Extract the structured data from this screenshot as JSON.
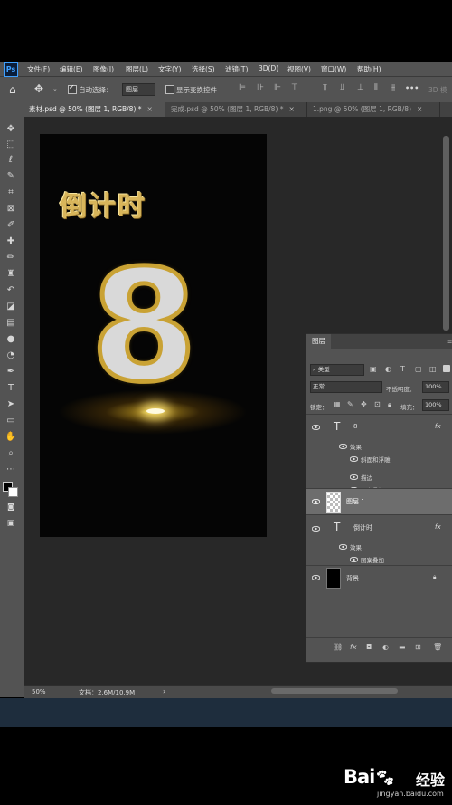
{
  "app": {
    "logo_text": "Ps"
  },
  "menu": [
    "文件(F)",
    "编辑(E)",
    "图像(I)",
    "图层(L)",
    "文字(Y)",
    "选择(S)",
    "滤镜(T)",
    "3D(D)",
    "视图(V)",
    "窗口(W)",
    "帮助(H)"
  ],
  "options": {
    "auto_select_label": "自动选择：",
    "auto_select_checked": true,
    "auto_select_target": "图层",
    "show_transform_label": "显示变换控件",
    "show_transform_checked": false,
    "more_label": "•••",
    "mode_3d_label": "3D 模"
  },
  "tabs": [
    {
      "title": "素材.psd @ 50% (图层 1, RGB/8) *",
      "close": "×",
      "active": true
    },
    {
      "title": "完成.psd @ 50% (图层 1, RGB/8) *",
      "close": "×",
      "active": false
    },
    {
      "title": "1.png @ 50% (图层 1, RGB/8)",
      "close": "×",
      "active": false
    }
  ],
  "canvas": {
    "title_text": "倒计时",
    "number_text": "8",
    "accent_gold": "#d8b55a"
  },
  "layers_panel": {
    "tab_label": "图层",
    "filter_kind": "类型",
    "blend_mode": "正常",
    "opacity_label": "不透明度：",
    "opacity_value": "100%",
    "lock_label": "锁定：",
    "fill_label": "填充：",
    "fill_value": "100%",
    "layers": [
      {
        "type": "text",
        "name": "8",
        "fx": "fx",
        "effects_label": "效果",
        "effects": [
          "斜面和浮雕",
          "描边",
          "图案叠加"
        ]
      },
      {
        "type": "pixel",
        "name": "图层 1",
        "selected": true
      },
      {
        "type": "text",
        "name": "倒计时",
        "fx": "fx",
        "effects_label": "效果",
        "effects": [
          "图案叠加"
        ]
      },
      {
        "type": "background",
        "name": "背景",
        "locked": true
      }
    ]
  },
  "status": {
    "zoom": "50%",
    "doc_info": "文档：2.6M/10.9M",
    "arrow": "›"
  },
  "watermark": {
    "brand": "Bai",
    "brand_suffix": "百",
    "cn": "经验",
    "url": "jingyan.baidu.com"
  }
}
